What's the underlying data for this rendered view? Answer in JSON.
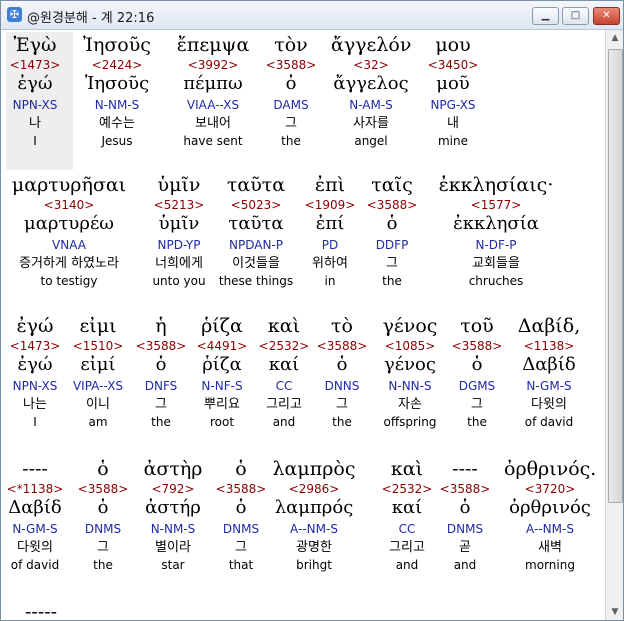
{
  "window": {
    "title": "@원경분해 - 계 22:16",
    "app_icon": "bible-app-icon",
    "buttons": {
      "minimize": "▁",
      "maximize": "□",
      "close": "✕"
    }
  },
  "verse": {
    "lines": [
      {
        "words": [
          {
            "greek": "Ἐγὼ",
            "strong": "<1473>",
            "lemma": "ἐγώ",
            "parse": "NPN-XS",
            "korean": "나",
            "english": "I"
          },
          {
            "greek": "Ἰησοῦς",
            "strong": "<2424>",
            "lemma": "Ἰησοῦς",
            "parse": "N-NM-S",
            "korean": "예수는",
            "english": "Jesus"
          },
          {
            "greek": "ἔπεμψα",
            "strong": "<3992>",
            "lemma": "πέμπω",
            "parse": "VIAA--XS",
            "korean": "보내어",
            "english": "have sent"
          },
          {
            "greek": "τὸν",
            "strong": "<3588>",
            "lemma": "ὁ",
            "parse": "DAMS",
            "korean": "그",
            "english": "the"
          },
          {
            "greek": "ἄγγελόν",
            "strong": "<32>",
            "lemma": "ἄγγελος",
            "parse": "N-AM-S",
            "korean": "사자를",
            "english": "angel"
          },
          {
            "greek": "μου",
            "strong": "<3450>",
            "lemma": "μοῦ",
            "parse": "NPG-XS",
            "korean": "내",
            "english": "mine"
          }
        ]
      },
      {
        "words": [
          {
            "greek": "μαρτυρῆσαι",
            "strong": "<3140>",
            "lemma": "μαρτυρέω",
            "parse": "VNAA",
            "korean": "증거하게 하였노라",
            "english": "to testigy"
          },
          {
            "greek": "ὑμῖν",
            "strong": "<5213>",
            "lemma": "ὑμῖν",
            "parse": "NPD-YP",
            "korean": "너희에게",
            "english": "unto you"
          },
          {
            "greek": "ταῦτα",
            "strong": "<5023>",
            "lemma": "ταῦτα",
            "parse": "NPDAN-P",
            "korean": "이것들을",
            "english": "these things"
          },
          {
            "greek": "ἐπὶ",
            "strong": "<1909>",
            "lemma": "ἐπί",
            "parse": "PD",
            "korean": "위하여",
            "english": "in"
          },
          {
            "greek": "ταῖς",
            "strong": "<3588>",
            "lemma": "ὁ",
            "parse": "DDFP",
            "korean": "그",
            "english": "the"
          },
          {
            "greek": "ἐκκλησίαις·",
            "strong": "<1577>",
            "lemma": "ἐκκλησία",
            "parse": "N-DF-P",
            "korean": "교회들을",
            "english": "chruches"
          }
        ]
      },
      {
        "words": [
          {
            "greek": "ἐγώ",
            "strong": "<1473>",
            "lemma": "ἐγώ",
            "parse": "NPN-XS",
            "korean": "나는",
            "english": "I"
          },
          {
            "greek": "εἰμι",
            "strong": "<1510>",
            "lemma": "εἰμί",
            "parse": "VIPA--XS",
            "korean": "이니",
            "english": "am"
          },
          {
            "greek": "ἡ",
            "strong": "<3588>",
            "lemma": "ὁ",
            "parse": "DNFS",
            "korean": "그",
            "english": "the"
          },
          {
            "greek": "ῥίζα",
            "strong": "<4491>",
            "lemma": "ῥίζα",
            "parse": "N-NF-S",
            "korean": "뿌리요",
            "english": "root"
          },
          {
            "greek": "καὶ",
            "strong": "<2532>",
            "lemma": "καί",
            "parse": "CC",
            "korean": "그리고",
            "english": "and"
          },
          {
            "greek": "τὸ",
            "strong": "<3588>",
            "lemma": "ὁ",
            "parse": "DNNS",
            "korean": "그",
            "english": "the"
          },
          {
            "greek": "γένος",
            "strong": "<1085>",
            "lemma": "γένος",
            "parse": "N-NN-S",
            "korean": "자손",
            "english": "offspring"
          },
          {
            "greek": "τοῦ",
            "strong": "<3588>",
            "lemma": "ὁ",
            "parse": "DGMS",
            "korean": "그",
            "english": "the"
          },
          {
            "greek": "Δαβίδ,",
            "strong": "<1138>",
            "lemma": "Δαβίδ",
            "parse": "N-GM-S",
            "korean": "다윗의",
            "english": "of david"
          }
        ]
      },
      {
        "words": [
          {
            "greek": "----",
            "strong": "<*1138>",
            "lemma": "Δαβίδ",
            "parse": "N-GM-S",
            "korean": "다윗의",
            "english": "of david"
          },
          {
            "greek": "ὁ",
            "strong": "<3588>",
            "lemma": "ὁ",
            "parse": "DNMS",
            "korean": "그",
            "english": "the"
          },
          {
            "greek": "ἀστὴρ",
            "strong": "<792>",
            "lemma": "ἀστήρ",
            "parse": "N-NM-S",
            "korean": "별이라",
            "english": "star"
          },
          {
            "greek": "ὁ",
            "strong": "<3588>",
            "lemma": "ὁ",
            "parse": "DNMS",
            "korean": "그",
            "english": "that"
          },
          {
            "greek": "λαμπρὸς",
            "strong": "<2986>",
            "lemma": "λαμπρός",
            "parse": "A--NM-S",
            "korean": "광명한",
            "english": "brihgt"
          },
          {
            "greek": "καὶ",
            "strong": "<2532>",
            "lemma": "καί",
            "parse": "CC",
            "korean": "그리고",
            "english": "and"
          },
          {
            "greek": "----",
            "strong": "<3588>",
            "lemma": "ὁ",
            "parse": "DNMS",
            "korean": "곧",
            "english": "and"
          },
          {
            "greek": "ὀρθρινός.",
            "strong": "<3720>",
            "lemma": "ὀρθρινός",
            "parse": "A--NM-S",
            "korean": "새벽",
            "english": "morning"
          }
        ]
      }
    ],
    "continuation": "-----"
  },
  "colors": {
    "strong": "#8b0000",
    "parse": "#1f2aa6",
    "text": "#000000",
    "selection": "#eeeeee"
  }
}
